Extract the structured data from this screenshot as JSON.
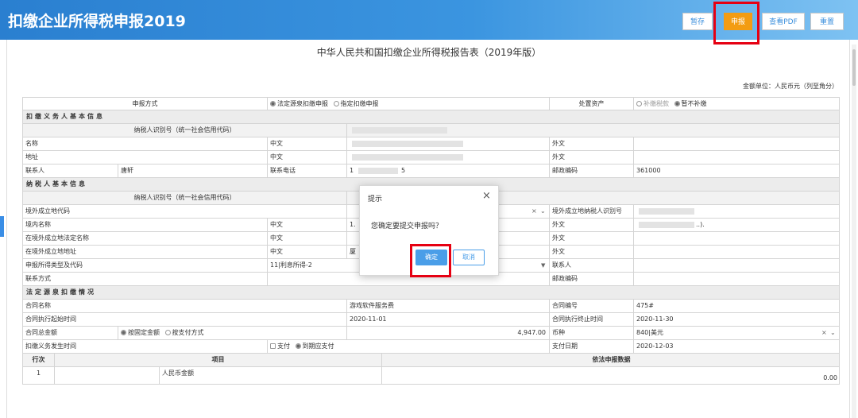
{
  "header": {
    "title": "扣缴企业所得税申报2019",
    "buttons": {
      "save": "暂存",
      "submit": "申报",
      "view_pdf": "查看PDF",
      "reset": "重置"
    }
  },
  "form": {
    "title": "中华人民共和国扣缴企业所得税报告表（2019年版）",
    "unit_note": "金额单位：人民币元（列至角分）",
    "declare_method_label": "申报方式",
    "declare_method_options": [
      "法定源泉扣缴申报",
      "指定扣缴申报"
    ],
    "asset_disposal_label": "处置资产",
    "asset_disposal_options": [
      "补缴税款",
      "暂不补缴"
    ],
    "withholder_section": "扣缴义务人基本信息",
    "taxpayer_id_label": "纳税人识别号（统一社会信用代码）",
    "name_label": "名称",
    "chinese_label": "中文",
    "foreign_label": "外文",
    "address_label": "地址",
    "contact_label": "联系人",
    "contact_value": "唐轩",
    "phone_label": "联系电话",
    "phone_value_partial": "1",
    "phone_value_tail": "5",
    "postal_label": "邮政编码",
    "postal_value": "361000",
    "taxpayer_section": "纳税人基本信息",
    "overseas_code_label": "境外成立地代码",
    "overseas_taxid_label": "境外成立地纳税人识别号",
    "domestic_name_label": "境内名称",
    "domestic_name_partial": "1.",
    "foreign_name_tail": "..).",
    "overseas_legal_name_label": "在境外成立地法定名称",
    "overseas_address_label": "在境外成立地地址",
    "overseas_address_partial": "厦",
    "income_type_label": "申报所得类型及代码",
    "income_type_value": "11|利息所得-2",
    "contact_info_label": "联系方式",
    "statutory_section": "法定源泉扣缴情况",
    "contract_name_label": "合同名称",
    "contract_name_value": "游戏软件服务费",
    "contract_no_label": "合同编号",
    "contract_no_value": "475#",
    "contract_start_label": "合同执行起始时间",
    "contract_start_value": "2020-11-01",
    "contract_end_label": "合同执行终止时间",
    "contract_end_value": "2020-11-30",
    "contract_total_label": "合同总金额",
    "contract_total_options": [
      "按固定金额",
      "按支付方式"
    ],
    "contract_total_value": "4,947.00",
    "currency_label": "币种",
    "currency_value": "840|美元",
    "withholding_time_label": "扣缴义务发生时间",
    "withholding_time_options": [
      "支付",
      "到期应支付"
    ],
    "payment_date_label": "支付日期",
    "payment_date_value": "2020-12-03",
    "table_col_row": "行次",
    "table_col_item": "项目",
    "table_col_data": "依法申报数据",
    "table_rows": [
      {
        "no": "1",
        "item": "人民币金额",
        "value": "0.00"
      }
    ]
  },
  "dialog": {
    "title": "提示",
    "message": "您确定要提交申报吗？",
    "confirm": "确定",
    "cancel": "取消"
  }
}
